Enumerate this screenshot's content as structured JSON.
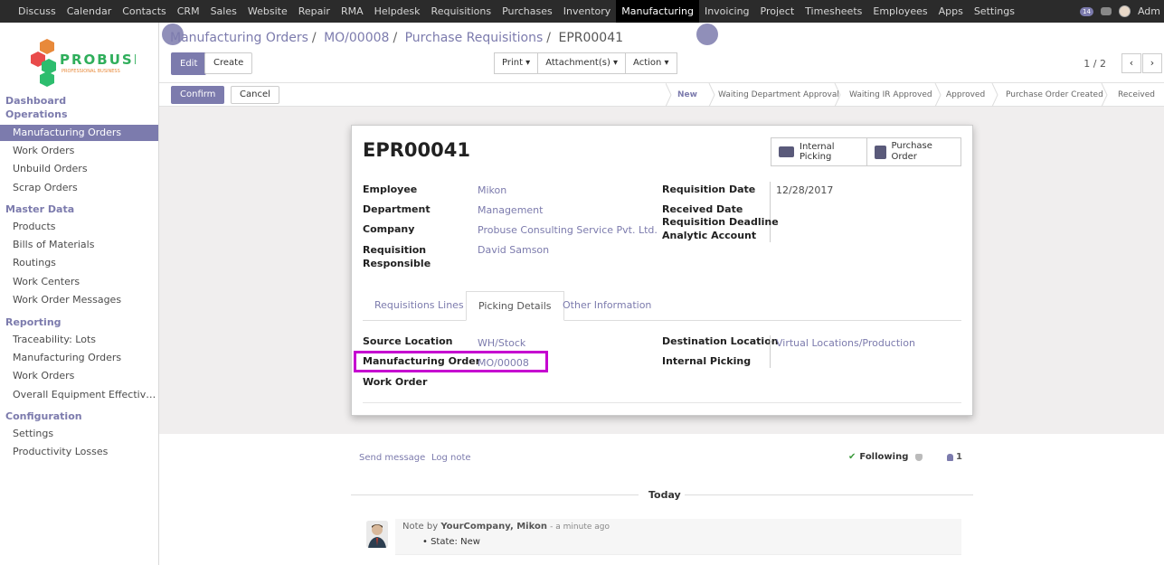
{
  "topbar": {
    "menu": [
      "Discuss",
      "Calendar",
      "Contacts",
      "CRM",
      "Sales",
      "Website",
      "Repair",
      "RMA",
      "Helpdesk",
      "Requisitions",
      "Purchases",
      "Inventory",
      "Manufacturing",
      "Invoicing",
      "Project",
      "Timesheets",
      "Employees",
      "Apps",
      "Settings"
    ],
    "active_menu": "Manufacturing",
    "message_count": "14",
    "user_name": "Adm"
  },
  "sidebar": {
    "logo_text": "PROBUSE",
    "logo_subtext": "PROFESSIONAL BUSINESS",
    "sections": {
      "dashboard": "Dashboard",
      "operations": "Operations",
      "master_data": "Master Data",
      "reporting": "Reporting",
      "configuration": "Configuration"
    },
    "operations_items": [
      "Manufacturing Orders",
      "Work Orders",
      "Unbuild Orders",
      "Scrap Orders"
    ],
    "master_items": [
      "Products",
      "Bills of Materials",
      "Routings",
      "Work Centers",
      "Work Order Messages"
    ],
    "reporting_items": [
      "Traceability: Lots",
      "Manufacturing Orders",
      "Work Orders",
      "Overall Equipment Effectiv…"
    ],
    "config_items": [
      "Settings",
      "Productivity Losses"
    ]
  },
  "breadcrumb": {
    "items": [
      "Manufacturing Orders",
      "MO/00008",
      "Purchase Requisitions"
    ],
    "current": "EPR00041"
  },
  "buttons": {
    "edit": "Edit",
    "create": "Create",
    "print": "Print ▾",
    "attachments": "Attachment(s) ▾",
    "action": "Action ▾",
    "confirm": "Confirm",
    "cancel": "Cancel",
    "prev": "‹",
    "next": "›"
  },
  "pager": "1 / 2",
  "statusbar": {
    "stages": [
      "New",
      "Waiting Department Approval",
      "Waiting IR Approved",
      "Approved",
      "Purchase Order Created",
      "Received"
    ],
    "current": "New"
  },
  "record": {
    "title": "EPR00041",
    "smart_internal_picking": "Internal Picking",
    "smart_purchase_order": "Purchase Order",
    "employee_label": "Employee",
    "employee": "Mikon",
    "department_label": "Department",
    "department": "Management",
    "company_label": "Company",
    "company": "Probuse Consulting Service Pvt. Ltd.",
    "responsible_label": "Requisition Responsible",
    "responsible": "David Samson",
    "req_date_label": "Requisition Date",
    "req_date": "12/28/2017",
    "received_date_label": "Received Date",
    "deadline_label": "Requisition Deadline",
    "analytic_label": "Analytic Account"
  },
  "tabs": [
    "Requisitions Lines",
    "Picking Details",
    "Other Information"
  ],
  "active_tab": "Picking Details",
  "picking": {
    "source_label": "Source Location",
    "source": "WH/Stock",
    "mo_label": "Manufacturing Order",
    "mo": "MO/00008",
    "wo_label": "Work Order",
    "dest_label": "Destination Location",
    "dest": "Virtual Locations/Production",
    "internal_label": "Internal Picking"
  },
  "chatter": {
    "send_message": "Send message",
    "log_note": "Log note",
    "following": "Following",
    "followers": "1",
    "today": "Today",
    "note_prefix": "Note by",
    "note_author": "YourCompany, Mikon",
    "note_time": "- a minute ago",
    "note_body": "State: New"
  },
  "colors": {
    "accent": "#7c7bad",
    "highlight": "#c500d0",
    "navbar": "#2b2b2b"
  }
}
